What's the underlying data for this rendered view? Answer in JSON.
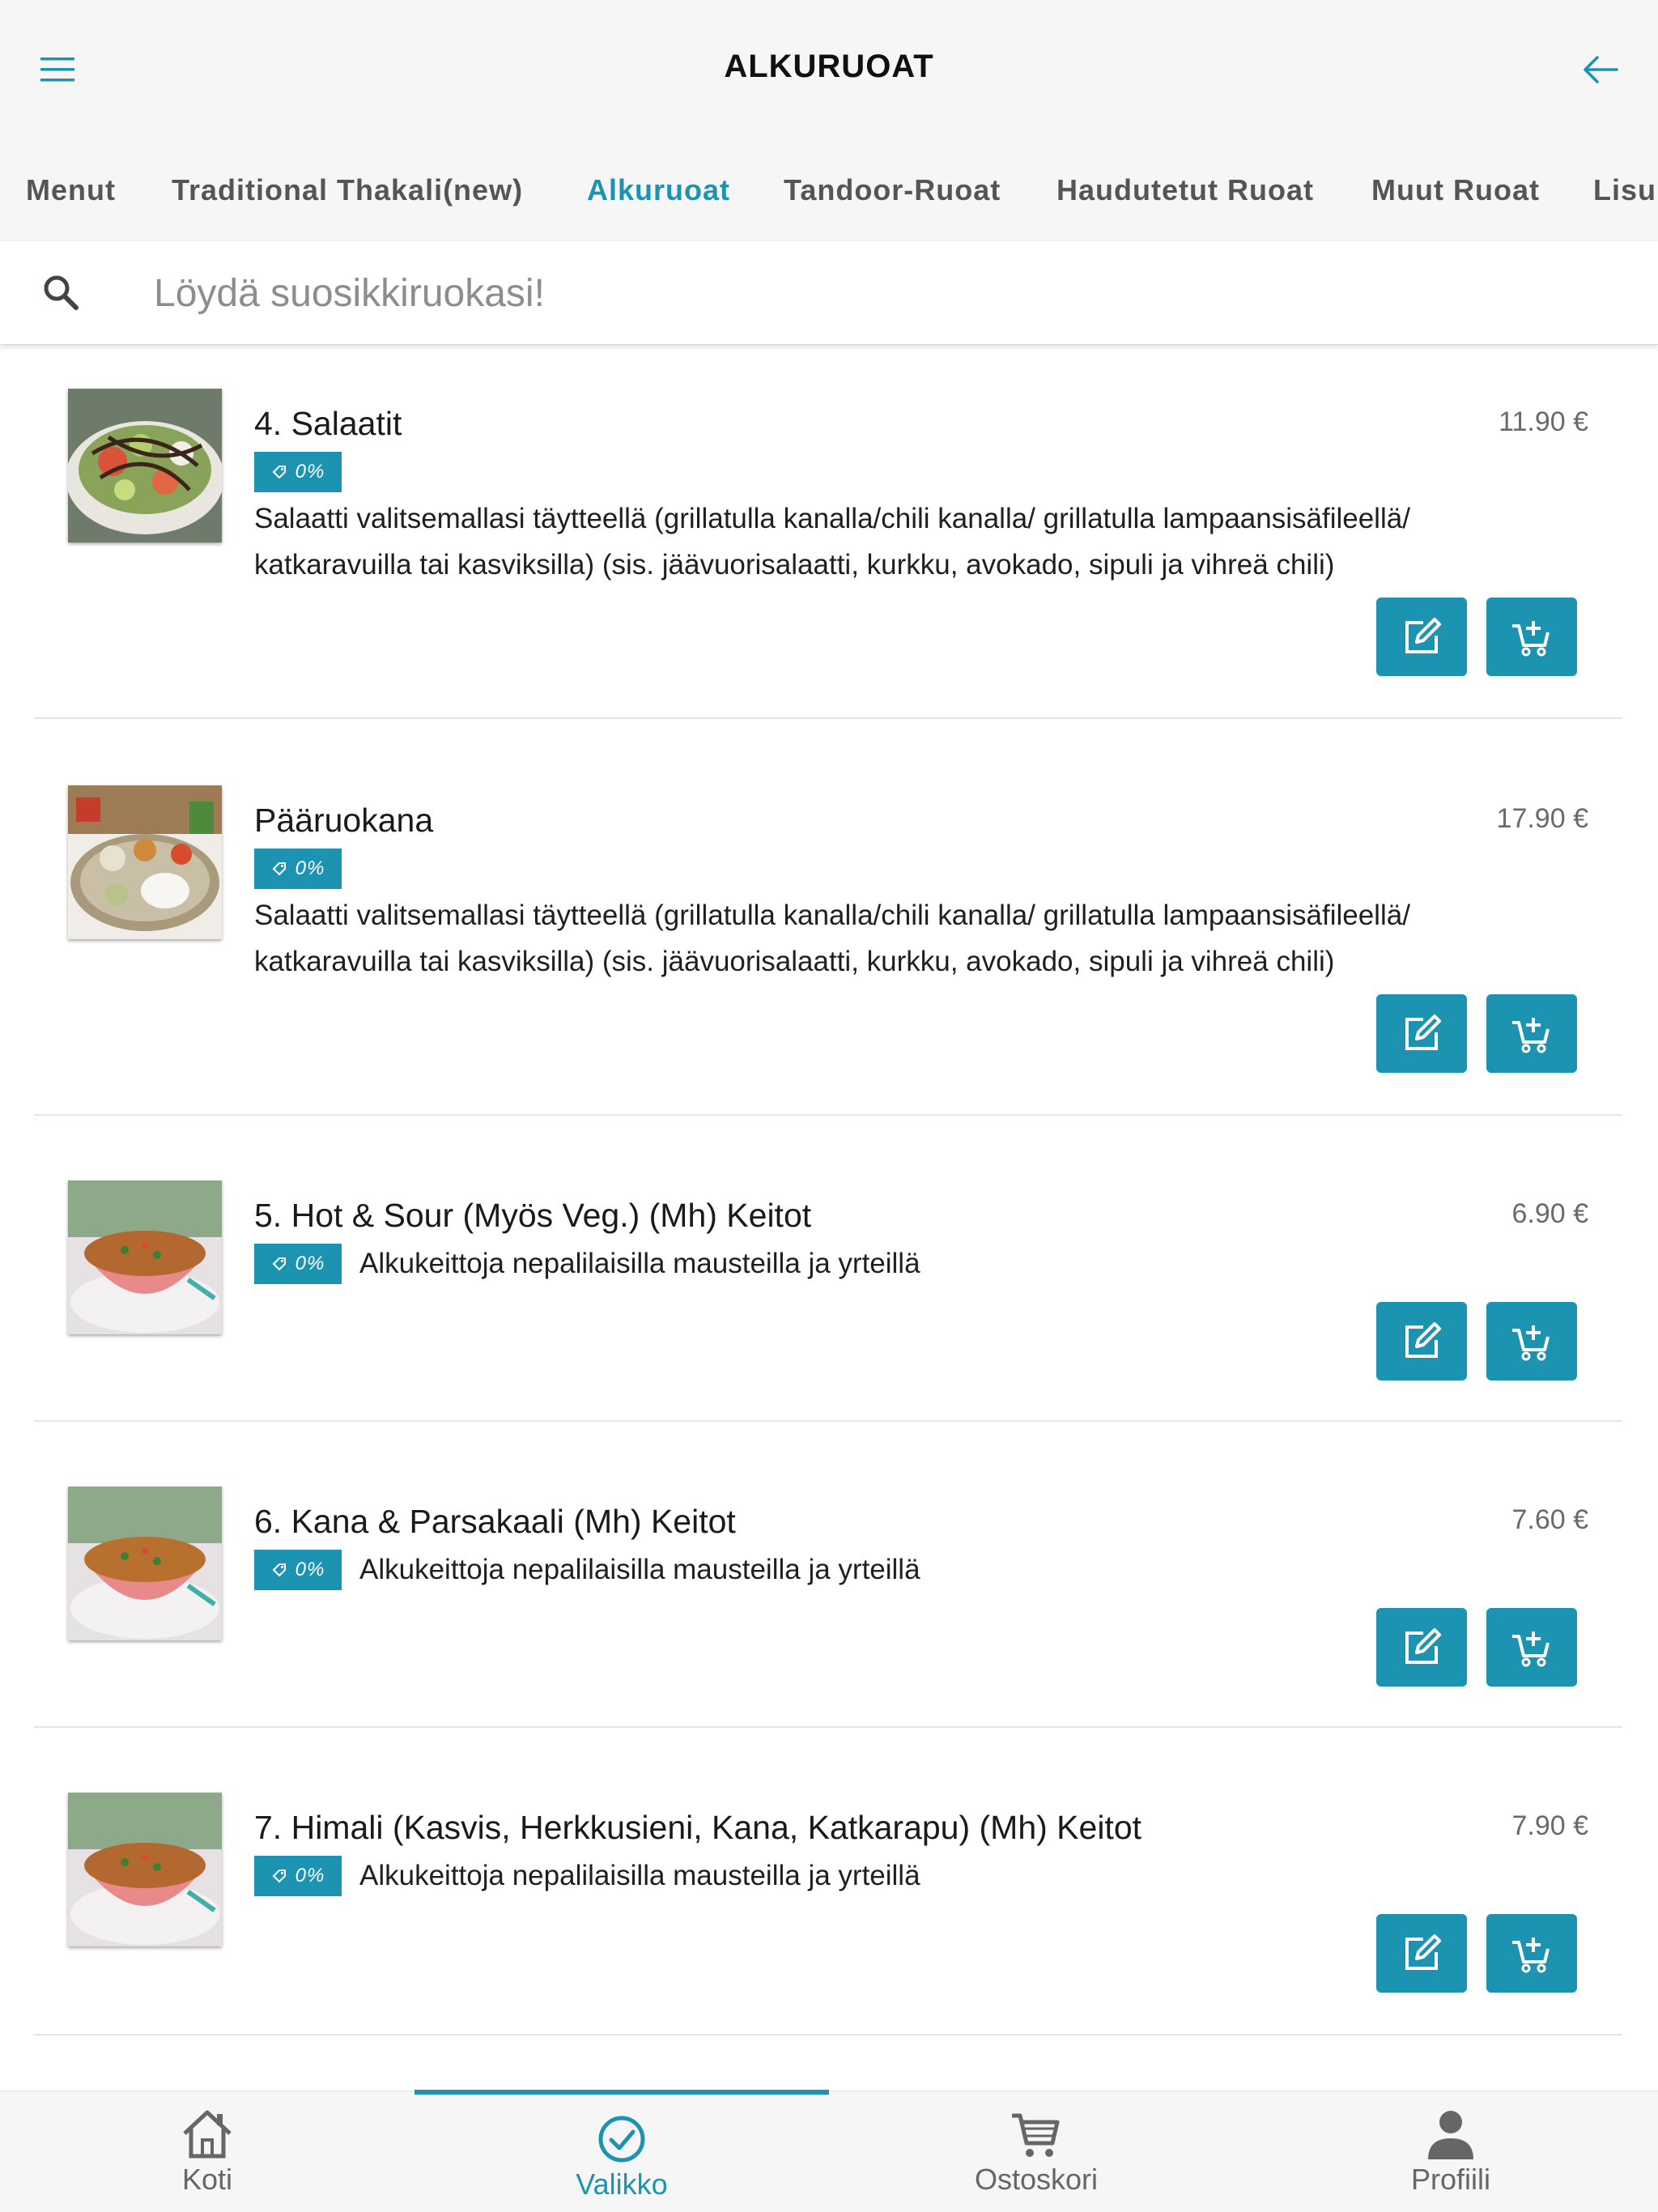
{
  "header": {
    "title": "ALKURUOAT",
    "menu_icon": "hamburger-icon",
    "back_icon": "arrow-left-icon"
  },
  "tabs": [
    {
      "label": "Menut",
      "active": false
    },
    {
      "label": "Traditional Thakali(new)",
      "active": false
    },
    {
      "label": "Alkuruoat",
      "active": true
    },
    {
      "label": "Tandoor-Ruoat",
      "active": false
    },
    {
      "label": "Haudutetut Ruoat",
      "active": false
    },
    {
      "label": "Muut Ruoat",
      "active": false
    },
    {
      "label": "Lisu",
      "active": false
    }
  ],
  "search": {
    "placeholder": "Löydä suosikkiruokasi!",
    "value": ""
  },
  "items": [
    {
      "name": "4. Salaatit",
      "price": "11.90 €",
      "badge": "0%",
      "desc": "Salaatti valitsemallasi täytteellä (grillatulla kanalla/chili kanalla/ grillatulla lampaansisäfileellä/ katkaravuilla tai kasviksilla) (sis. jäävuorisalaatti, kurkku, avokado, sipuli ja vihreä chili)",
      "image": "salad-image"
    },
    {
      "name": "Pääruokana",
      "price": "17.90 €",
      "badge": "0%",
      "desc": "Salaatti valitsemallasi täytteellä (grillatulla kanalla/chili kanalla/ grillatulla lampaansisäfileellä/ katkaravuilla tai kasviksilla) (sis. jäävuorisalaatti, kurkku, avokado, sipuli ja vihreä chili)",
      "image": "thali-plate-image"
    },
    {
      "name": "5. Hot & Sour (Myös Veg.) (Mh) Keitot",
      "price": "6.90 €",
      "badge": "0%",
      "desc": "Alkukeittoja nepalilaisilla mausteilla ja yrteillä",
      "image": "soup-bowl-image"
    },
    {
      "name": "6. Kana & Parsakaali (Mh) Keitot",
      "price": "7.60 €",
      "badge": "0%",
      "desc": "Alkukeittoja nepalilaisilla mausteilla ja yrteillä",
      "image": "soup-bowl-image"
    },
    {
      "name": "7. Himali (Kasvis, Herkkusieni, Kana, Katkarapu) (Mh) Keitot",
      "price": "7.90 €",
      "badge": "0%",
      "desc": "Alkukeittoja nepalilaisilla mausteilla ja yrteillä",
      "image": "soup-bowl-image"
    }
  ],
  "bottom_nav": [
    {
      "label": "Koti",
      "icon": "home-icon",
      "active": false
    },
    {
      "label": "Valikko",
      "icon": "check-circle-icon",
      "active": true
    },
    {
      "label": "Ostoskori",
      "icon": "cart-icon",
      "active": false
    },
    {
      "label": "Profiili",
      "icon": "person-icon",
      "active": false
    }
  ],
  "colors": {
    "accent": "#1c93b0",
    "bar_background": "#f6f6f6",
    "text": "#1a1a1a",
    "muted": "#6a6a6a"
  }
}
